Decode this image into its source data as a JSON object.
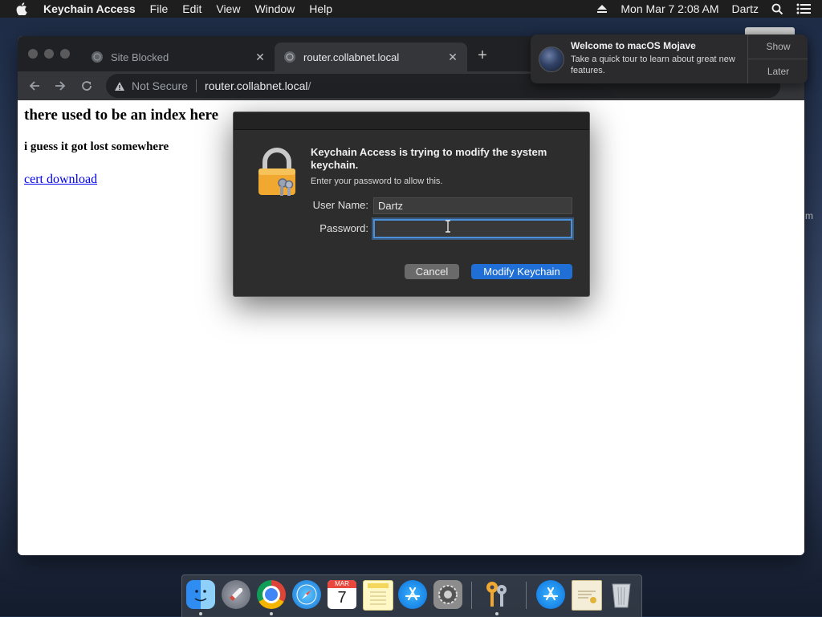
{
  "menubar": {
    "app_name": "Keychain Access",
    "items": [
      "File",
      "Edit",
      "View",
      "Window",
      "Help"
    ],
    "datetime": "Mon Mar 7  2:08 AM",
    "user": "Dartz"
  },
  "browser": {
    "tabs": [
      {
        "title": "Site Blocked",
        "active": false
      },
      {
        "title": "router.collabnet.local",
        "active": true
      }
    ],
    "omnibox": {
      "security_label": "Not Secure",
      "url_host": "router.collabnet.local",
      "url_path": "/"
    },
    "page": {
      "heading": "there used to be an index here",
      "subheading": "i guess it got lost somewhere",
      "link": "cert download"
    }
  },
  "notification": {
    "title": "Welcome to macOS Mojave",
    "body": "Take a quick tour to learn about great new features.",
    "show_label": "Show",
    "later_label": "Later"
  },
  "side_fragment": "m",
  "dialog": {
    "heading": "Keychain Access is trying to modify the system keychain.",
    "subtext": "Enter your password to allow this.",
    "username_label": "User Name:",
    "username_value": "Dartz",
    "password_label": "Password:",
    "password_value": "",
    "cancel_label": "Cancel",
    "confirm_label": "Modify Keychain"
  },
  "calendar_icon": {
    "month": "MAR",
    "day": "7"
  },
  "dock": {
    "items": [
      "finder",
      "launchpad",
      "chrome",
      "safari",
      "calendar",
      "notes",
      "app-store",
      "system-preferences",
      "keychain-access",
      "downloads-app-store",
      "certificate",
      "trash"
    ],
    "running": [
      "finder",
      "chrome",
      "keychain-access"
    ]
  },
  "colors": {
    "accent": "#1f6fd6",
    "focus_ring": "#4a8fd9",
    "link": "#0000ee"
  }
}
